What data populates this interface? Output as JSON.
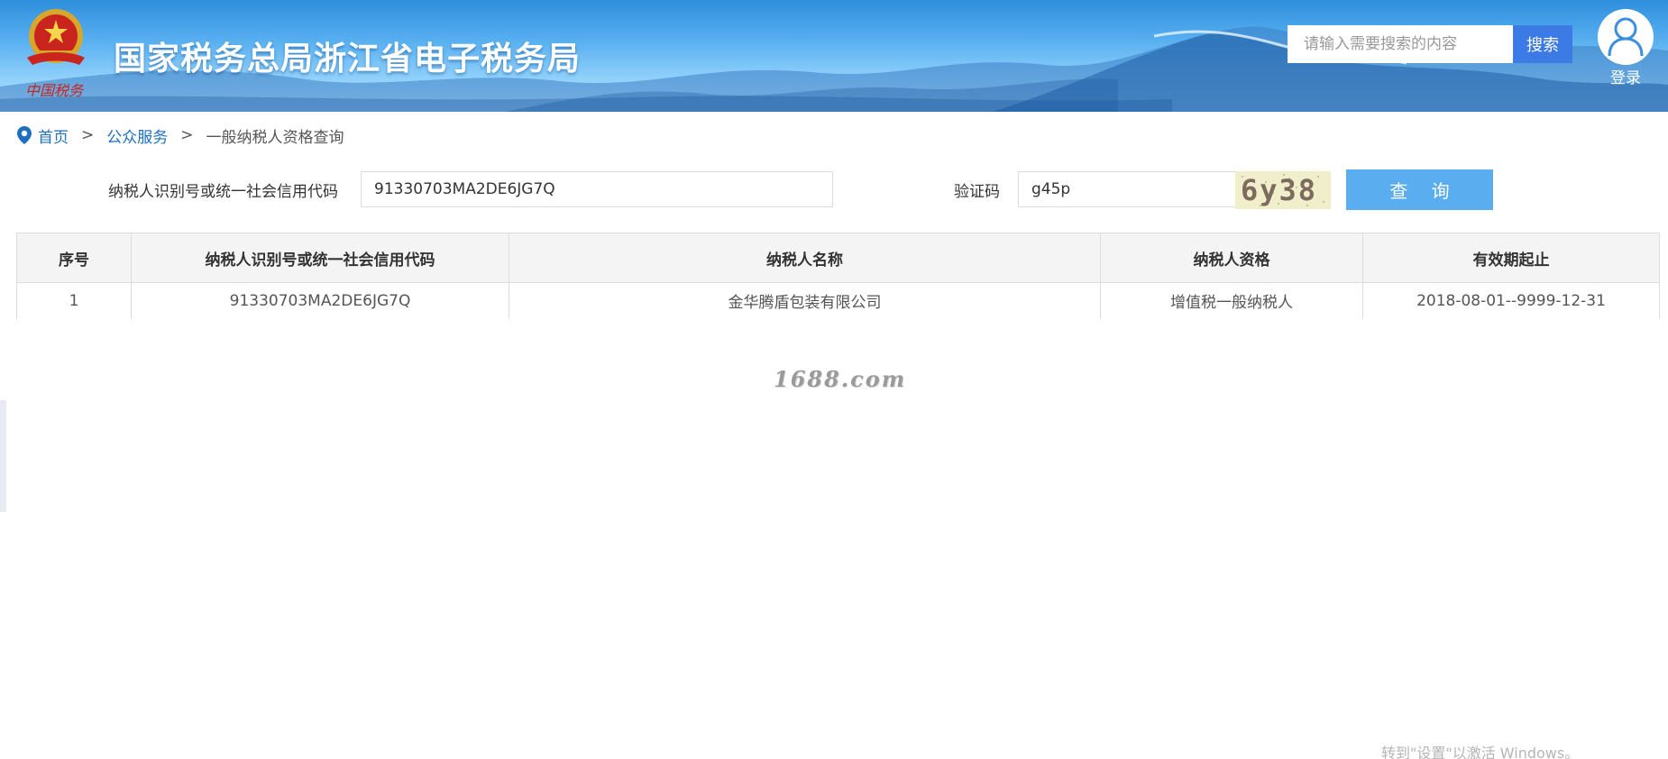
{
  "header": {
    "site_title": "国家税务总局浙江省电子税务局",
    "search_placeholder": "请输入需要搜索的内容",
    "search_button": "搜索",
    "login_label": "登录",
    "emblem_icon": "national-tax-emblem",
    "emblem_caption_icon": "china-tax-calligraphy"
  },
  "breadcrumb": {
    "icon": "location-pin-icon",
    "items": [
      "首页",
      "公众服务",
      "一般纳税人资格查询"
    ],
    "separator": ">"
  },
  "query_form": {
    "taxpayer_id_label": "纳税人识别号或统一社会信用代码",
    "taxpayer_id_value": "91330703MA2DE6JG7Q",
    "captcha_label": "验证码",
    "captcha_value": "g45p",
    "captcha_image_text": "6y38",
    "query_button": "查 询"
  },
  "result_table": {
    "headers": [
      "序号",
      "纳税人识别号或统一社会信用代码",
      "纳税人名称",
      "纳税人资格",
      "有效期起止"
    ],
    "rows": [
      [
        "1",
        "91330703MA2DE6JG7Q",
        "金华腾盾包装有限公司",
        "增值税一般纳税人",
        "2018-08-01--9999-12-31"
      ]
    ]
  },
  "watermark": "1688.com",
  "os_overlay": "转到\"设置\"以激活 Windows。",
  "colors": {
    "banner_top": "#2f8fdc",
    "search_button": "#3c7ae6",
    "query_button": "#5aaef0",
    "link": "#1e6fc0",
    "table_header_bg": "#f4f4f4"
  }
}
